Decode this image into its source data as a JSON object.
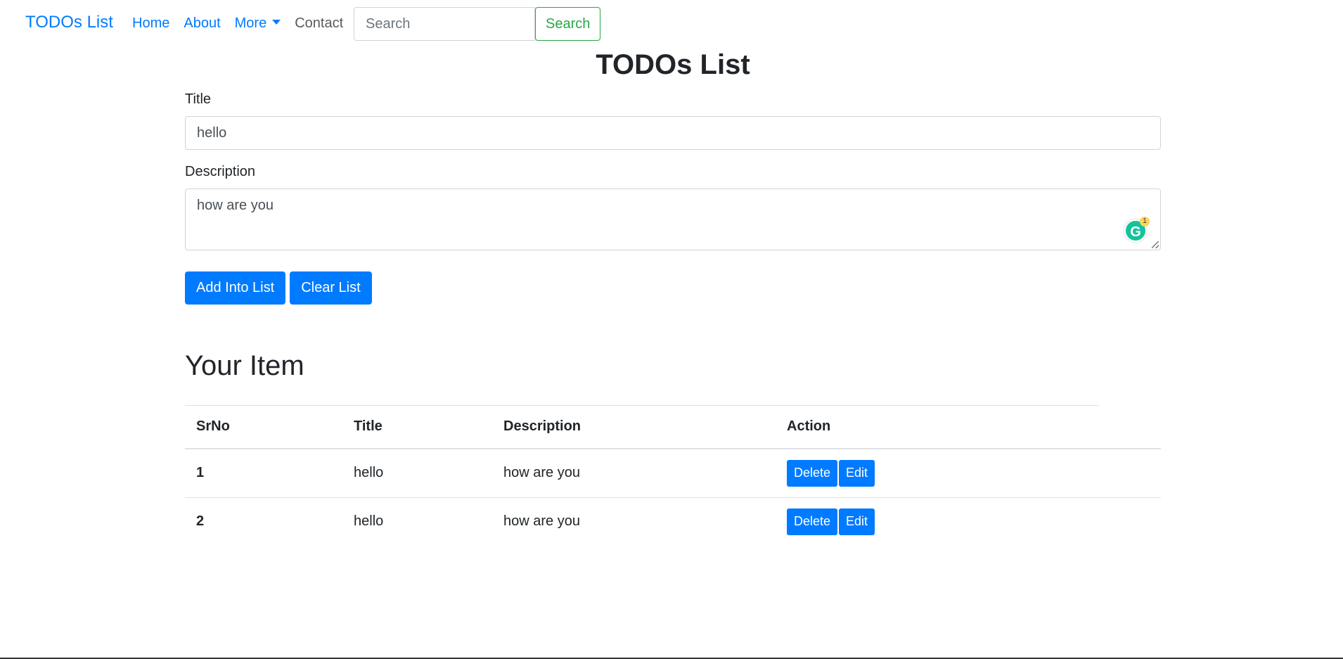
{
  "navbar": {
    "brand": "TODOs List",
    "links": [
      {
        "label": "Home"
      },
      {
        "label": "About"
      },
      {
        "label": "More"
      },
      {
        "label": "Contact"
      }
    ],
    "search": {
      "placeholder": "Search",
      "button_label": "Search"
    }
  },
  "main": {
    "title": "TODOs List",
    "form": {
      "title_label": "Title",
      "title_value": "hello",
      "description_label": "Description",
      "description_value": "how are you",
      "grammarly_count": "1",
      "add_button": "Add Into List",
      "clear_button": "Clear List"
    },
    "section_title": "Your Item",
    "table": {
      "headers": [
        "SrNo",
        "Title",
        "Description",
        "Action"
      ],
      "rows": [
        {
          "srno": "1",
          "title": "hello",
          "description": "how are you"
        },
        {
          "srno": "2",
          "title": "hello",
          "description": "how are you"
        }
      ],
      "delete_label": "Delete",
      "edit_label": "Edit"
    }
  }
}
